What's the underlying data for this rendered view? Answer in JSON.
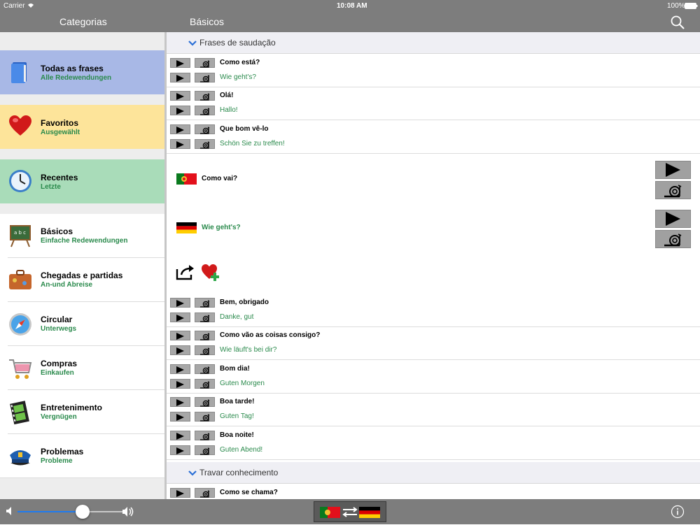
{
  "status": {
    "carrier": "Carrier",
    "time": "10:08 AM",
    "battery": "100%"
  },
  "nav": {
    "left_title": "Categorias",
    "right_title": "Básicos",
    "search_icon": "search-icon"
  },
  "sidebar": {
    "items": [
      {
        "pt": "Todas as frases",
        "de": "Alle Redewendungen",
        "icon": "book-icon",
        "bg": "#a8b8e6"
      },
      {
        "pt": "Favoritos",
        "de": "Ausgewählt",
        "icon": "heart-icon",
        "bg": "#fde49a"
      },
      {
        "pt": "Recentes",
        "de": "Letzte",
        "icon": "clock-icon",
        "bg": "#a9dcb9"
      },
      {
        "pt": "Básicos",
        "de": "Einfache Redewendungen",
        "icon": "chalkboard-icon",
        "bg": "#ffffff"
      },
      {
        "pt": "Chegadas e partidas",
        "de": "An-und Abreise",
        "icon": "suitcase-icon",
        "bg": "#ffffff"
      },
      {
        "pt": "Circular",
        "de": "Unterwegs",
        "icon": "compass-icon",
        "bg": "#ffffff"
      },
      {
        "pt": "Compras",
        "de": "Einkaufen",
        "icon": "cart-icon",
        "bg": "#ffffff"
      },
      {
        "pt": "Entretenimento",
        "de": "Vergnügen",
        "icon": "film-icon",
        "bg": "#ffffff"
      },
      {
        "pt": "Problemas",
        "de": "Probleme",
        "icon": "police-cap-icon",
        "bg": "#ffffff"
      }
    ]
  },
  "sections": [
    {
      "title": "Frases de saudação"
    },
    {
      "title": "Travar conhecimento"
    }
  ],
  "phrases": [
    {
      "pt": "Como está?",
      "de": "Wie geht's?"
    },
    {
      "pt": "Olá!",
      "de": "Hallo!"
    },
    {
      "pt": "Que bom vê-lo",
      "de": "Schön Sie zu treffen!"
    },
    {
      "pt": "Bem, obrigado",
      "de": "Danke, gut"
    },
    {
      "pt": "Como vão as coisas consigo?",
      "de": "Wie läuft's bei dir?"
    },
    {
      "pt": "Bom dia!",
      "de": "Guten Morgen"
    },
    {
      "pt": "Boa tarde!",
      "de": "Guten Tag!"
    },
    {
      "pt": "Boa noite!",
      "de": "Guten Abend!"
    },
    {
      "pt": "Como se chama?",
      "de": ""
    }
  ],
  "expanded": {
    "pt": "Como vai?",
    "de": "Wie geht's?",
    "pt_flag": "portugal-flag-icon",
    "de_flag": "germany-flag-icon",
    "share_icon": "share-icon",
    "fav_icon": "heart-add-icon"
  },
  "bottom": {
    "volume": 0.6,
    "info_icon": "info-icon",
    "switch_icon": "language-swap-icon"
  },
  "colors": {
    "bar": "#7d7d7d",
    "accent_green": "#2a8a4c",
    "accent_blue": "#1e7bf0"
  }
}
